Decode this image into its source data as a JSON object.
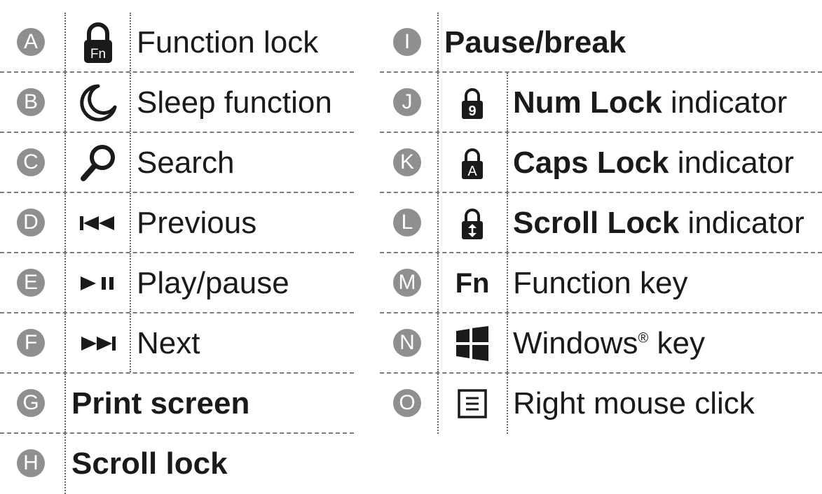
{
  "left": [
    {
      "letter": "A",
      "label": "Function lock",
      "icon": "fn-lock-icon"
    },
    {
      "letter": "B",
      "label": "Sleep function",
      "icon": "moon-icon"
    },
    {
      "letter": "C",
      "label": "Search",
      "icon": "search-icon"
    },
    {
      "letter": "D",
      "label": "Previous",
      "icon": "previous-track-icon"
    },
    {
      "letter": "E",
      "label": "Play/pause",
      "icon": "play-pause-icon"
    },
    {
      "letter": "F",
      "label": "Next",
      "icon": "next-track-icon"
    },
    {
      "letter": "G",
      "label": "Print screen"
    },
    {
      "letter": "H",
      "label": "Scroll lock"
    }
  ],
  "right": [
    {
      "letter": "I",
      "label": "Pause/break"
    },
    {
      "letter": "J",
      "label_bold": "Num Lock",
      "label_rest": " indicator",
      "icon": "num-lock-icon",
      "lock_char": "9"
    },
    {
      "letter": "K",
      "label_bold": "Caps Lock",
      "label_rest": " indicator",
      "icon": "caps-lock-icon",
      "lock_char": "A"
    },
    {
      "letter": "L",
      "label_bold": "Scroll Lock",
      "label_rest": " indicator",
      "icon": "scroll-lock-icon"
    },
    {
      "letter": "M",
      "label": "Function key",
      "icon": "fn-key-icon",
      "icon_text": "Fn"
    },
    {
      "letter": "N",
      "label": "Windows",
      "label_sup": "®",
      "label_rest": " key",
      "icon": "windows-icon"
    },
    {
      "letter": "O",
      "label": "Right mouse click",
      "icon": "menu-key-icon"
    }
  ],
  "fn_lock_text": "Fn"
}
